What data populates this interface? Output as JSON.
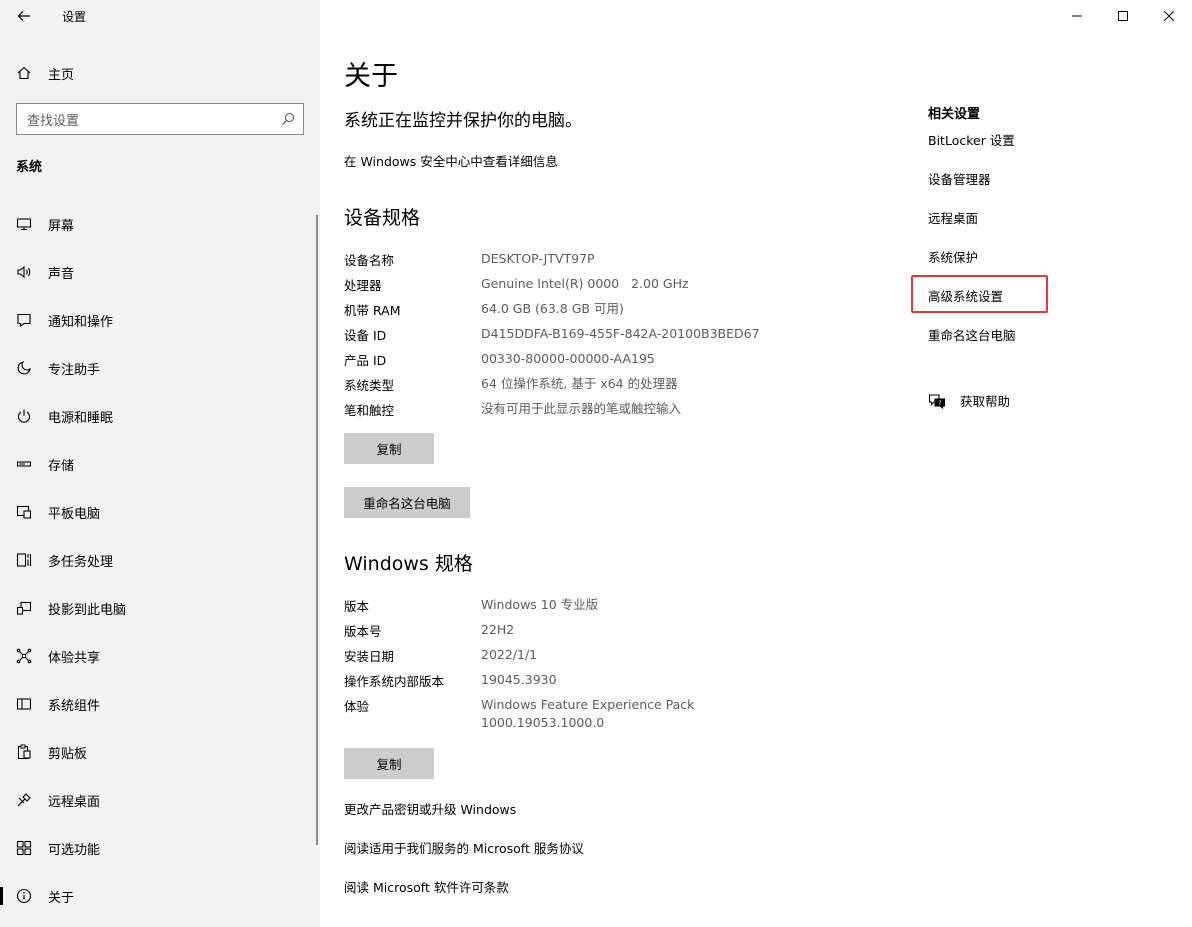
{
  "window": {
    "back_icon": "arrow-left-icon",
    "app_title": "设置",
    "controls": [
      "minimize-icon",
      "maximize-icon",
      "close-icon"
    ]
  },
  "sidebar": {
    "home_label": "主页",
    "search_placeholder": "查找设置",
    "section_title": "系统",
    "items": [
      {
        "label": "屏幕",
        "icon": "display-icon"
      },
      {
        "label": "声音",
        "icon": "speaker-icon"
      },
      {
        "label": "通知和操作",
        "icon": "notification-icon"
      },
      {
        "label": "专注助手",
        "icon": "moon-icon"
      },
      {
        "label": "电源和睡眠",
        "icon": "power-icon"
      },
      {
        "label": "存储",
        "icon": "storage-icon"
      },
      {
        "label": "平板电脑",
        "icon": "tablet-icon"
      },
      {
        "label": "多任务处理",
        "icon": "multitask-icon"
      },
      {
        "label": "投影到此电脑",
        "icon": "project-icon"
      },
      {
        "label": "体验共享",
        "icon": "share-icon"
      },
      {
        "label": "系统组件",
        "icon": "components-icon"
      },
      {
        "label": "剪贴板",
        "icon": "clipboard-icon"
      },
      {
        "label": "远程桌面",
        "icon": "remote-desktop-icon"
      },
      {
        "label": "可选功能",
        "icon": "optional-features-icon"
      },
      {
        "label": "关于",
        "icon": "info-icon",
        "active": true
      }
    ]
  },
  "main": {
    "title": "关于",
    "subtitle": "系统正在监控并保护你的电脑。",
    "security_link": "在 Windows 安全中心中查看详细信息",
    "device_specs": {
      "heading": "设备规格",
      "rows": [
        {
          "key": "设备名称",
          "value": "DESKTOP-JTVT97P"
        },
        {
          "key": "处理器",
          "value": "Genuine Intel(R) 0000   2.00 GHz"
        },
        {
          "key": "机带 RAM",
          "value": "64.0 GB (63.8 GB 可用)"
        },
        {
          "key": "设备 ID",
          "value": "D415DDFA-B169-455F-842A-20100B3BED67"
        },
        {
          "key": "产品 ID",
          "value": "00330-80000-00000-AA195"
        },
        {
          "key": "系统类型",
          "value": "64 位操作系统, 基于 x64 的处理器"
        },
        {
          "key": "笔和触控",
          "value": "没有可用于此显示器的笔或触控输入"
        }
      ],
      "copy_label": "复制",
      "rename_label": "重命名这台电脑"
    },
    "windows_specs": {
      "heading": "Windows 规格",
      "rows": [
        {
          "key": "版本",
          "value": "Windows 10 专业版"
        },
        {
          "key": "版本号",
          "value": "22H2"
        },
        {
          "key": "安装日期",
          "value": "2022/1/1"
        },
        {
          "key": "操作系统内部版本",
          "value": "19045.3930"
        },
        {
          "key": "体验",
          "value": "Windows Feature Experience Pack",
          "value2": "1000.19053.1000.0"
        }
      ],
      "copy_label": "复制"
    },
    "links": [
      "更改产品密钥或升级 Windows",
      "阅读适用于我们服务的 Microsoft 服务协议",
      "阅读 Microsoft 软件许可条款"
    ]
  },
  "related": {
    "title": "相关设置",
    "links": [
      "BitLocker 设置",
      "设备管理器",
      "远程桌面",
      "系统保护",
      "高级系统设置",
      "重命名这台电脑"
    ],
    "highlight_color": "#e53935",
    "help_label": "获取帮助",
    "help_icon": "help-chat-icon"
  }
}
